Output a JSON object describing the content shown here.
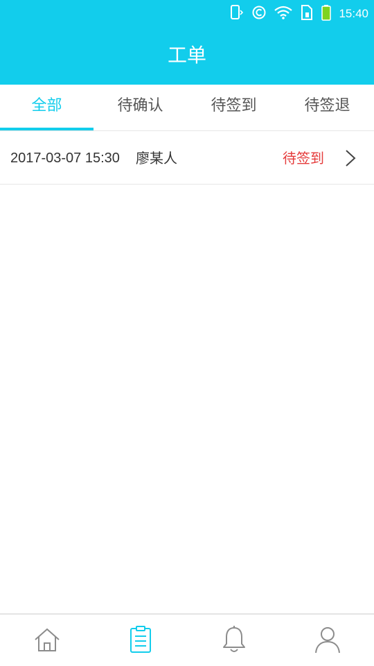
{
  "status_bar": {
    "time": "15:40",
    "icons": [
      "phone-vibrate-icon",
      "c-circle-icon",
      "wifi-icon",
      "sim-icon",
      "battery-icon"
    ]
  },
  "header": {
    "title": "工单"
  },
  "tabs": [
    {
      "label": "全部",
      "active": true
    },
    {
      "label": "待确认",
      "active": false
    },
    {
      "label": "待签到",
      "active": false
    },
    {
      "label": "待签退",
      "active": false
    }
  ],
  "orders": [
    {
      "datetime": "2017-03-07 15:30",
      "person": "廖某人",
      "status": "待签到"
    }
  ],
  "bottom_nav": {
    "items": [
      {
        "icon": "home-icon",
        "active": false
      },
      {
        "icon": "clipboard-icon",
        "active": true
      },
      {
        "icon": "bell-icon",
        "active": false
      },
      {
        "icon": "user-icon",
        "active": false
      }
    ]
  },
  "colors": {
    "accent": "#12cdec",
    "status_red": "#e53b3b",
    "text": "#333333",
    "tab_inactive": "#555555",
    "battery_green": "#7ed321"
  }
}
